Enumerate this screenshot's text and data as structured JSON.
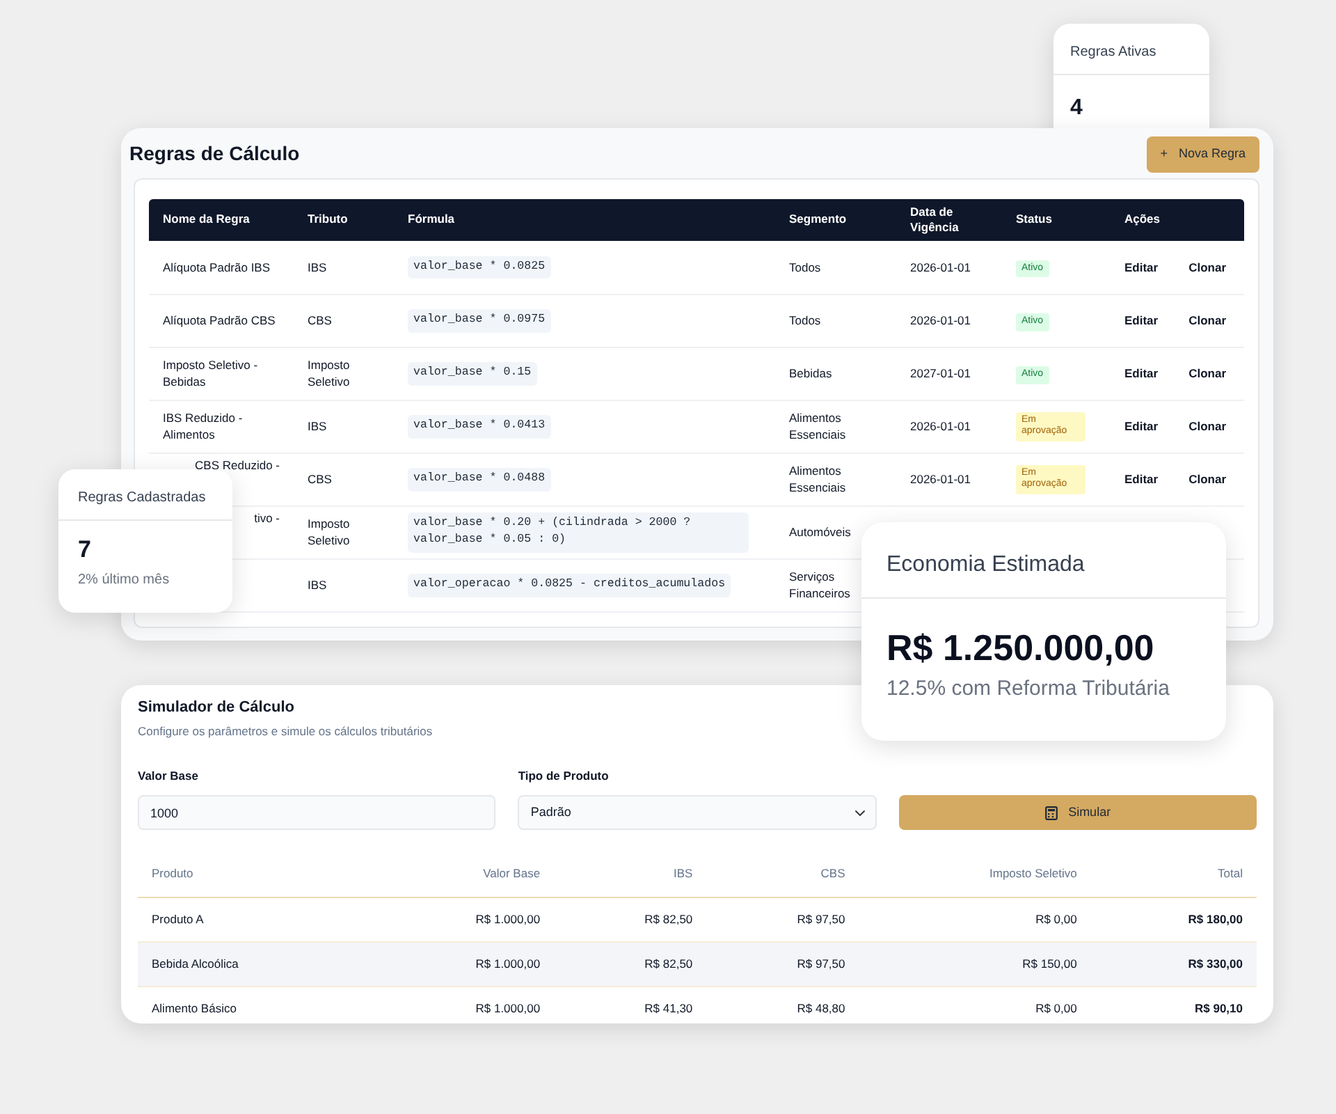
{
  "rules_panel": {
    "title": "Regras de Cálculo",
    "new_button": {
      "icon": "+",
      "label": "Nova Regra"
    },
    "table": {
      "columns": [
        "Nome da Regra",
        "Tributo",
        "Fórmula",
        "Segmento",
        "Data de Vigência",
        "Status",
        "Ações"
      ],
      "rows": [
        {
          "name": "Alíquota Padrão IBS",
          "tax": "IBS",
          "formula": "valor_base * 0.0825",
          "segment": "Todos",
          "date": "2026-01-01",
          "status": {
            "label": "Ativo",
            "kind": "active"
          },
          "actions": [
            "Editar",
            "Clonar"
          ]
        },
        {
          "name": "Alíquota Padrão CBS",
          "tax": "CBS",
          "formula": "valor_base * 0.0975",
          "segment": "Todos",
          "date": "2026-01-01",
          "status": {
            "label": "Ativo",
            "kind": "active"
          },
          "actions": [
            "Editar",
            "Clonar"
          ]
        },
        {
          "name": "Imposto Seletivo - Bebidas",
          "tax": "Imposto Seletivo",
          "formula": "valor_base * 0.15",
          "segment": "Bebidas",
          "date": "2027-01-01",
          "status": {
            "label": "Ativo",
            "kind": "active"
          },
          "actions": [
            "Editar",
            "Clonar"
          ]
        },
        {
          "name": "IBS Reduzido - Alimentos",
          "tax": "IBS",
          "formula": "valor_base * 0.0413",
          "segment": "Alimentos Essenciais",
          "date": "2026-01-01",
          "status": {
            "label": "Em aprovação",
            "kind": "pending"
          },
          "actions": [
            "Editar",
            "Clonar"
          ]
        },
        {
          "name": "CBS Reduzido -",
          "partly_hidden": true,
          "tax": "CBS",
          "formula": "valor_base * 0.0488",
          "segment": "Alimentos Essenciais",
          "date": "2026-01-01",
          "status": {
            "label": "Em aprovação",
            "kind": "pending"
          },
          "actions": [
            "Editar",
            "Clonar"
          ]
        },
        {
          "name": "tivo -",
          "partly_hidden": true,
          "tax": "Imposto Seletivo",
          "formula": "valor_base * 0.20 + (cilindrada > 2000 ? valor_base * 0.05 : 0)",
          "segment": "Automóveis"
        },
        {
          "tax": "IBS",
          "formula": "valor_operacao * 0.0825 - creditos_acumulados",
          "segment": "Serviços Financeiros"
        }
      ]
    }
  },
  "simulator": {
    "title": "Simulador de Cálculo",
    "subtitle": "Configure os parâmetros e simule os cálculos tributários",
    "base_field": {
      "label": "Valor Base",
      "value": "1000"
    },
    "product_field": {
      "label": "Tipo de Produto",
      "value": "Padrão"
    },
    "simulate_button": {
      "label": "Simular"
    },
    "results": {
      "columns": [
        "Produto",
        "Valor Base",
        "IBS",
        "CBS",
        "Imposto Seletivo",
        "Total"
      ],
      "rows": [
        {
          "cells": [
            "Produto A",
            "R$ 1.000,00",
            "R$ 82,50",
            "R$ 97,50",
            "R$ 0,00",
            "R$ 180,00"
          ],
          "highlighted": false
        },
        {
          "cells": [
            "Bebida Alcoólica",
            "R$ 1.000,00",
            "R$ 82,50",
            "R$ 97,50",
            "R$ 150,00",
            "R$ 330,00"
          ],
          "highlighted": true
        },
        {
          "cells": [
            "Alimento Básico",
            "R$ 1.000,00",
            "R$ 41,30",
            "R$ 48,80",
            "R$ 0,00",
            "R$ 90,10"
          ],
          "highlighted": false
        }
      ]
    }
  },
  "stat_cards": [
    {
      "title": "Regras Ativas",
      "value": "4"
    },
    {
      "title": "Regras Cadastradas",
      "value": "7",
      "note": "2% último mês"
    }
  ],
  "savings_card": {
    "title": "Economia Estimada",
    "value": "R$ 1.250.000,00",
    "note": "12.5% com Reforma Tributária"
  }
}
